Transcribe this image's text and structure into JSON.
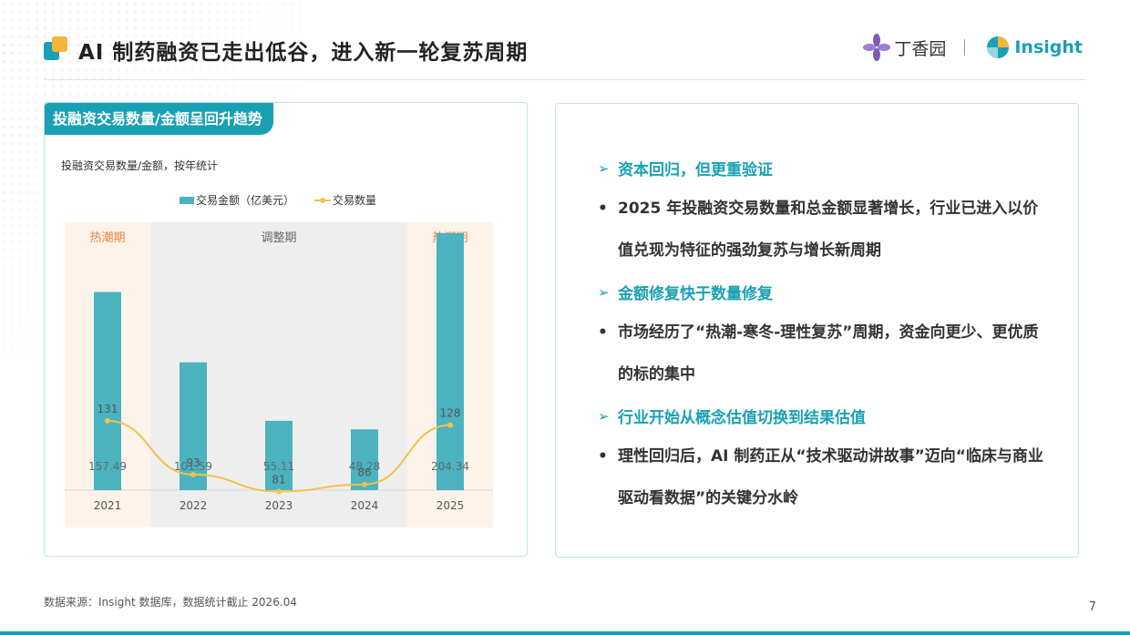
{
  "header": {
    "title": "AI 制药融资已走出低谷，进入新一轮复苏周期",
    "logo_left": "丁香园",
    "logo_right": "Insight"
  },
  "left_panel": {
    "tag": "投融资交易数量/金额呈回升趋势",
    "subtitle": "投融资交易数量/金额，按年统计"
  },
  "chart_data": {
    "type": "bar",
    "categories": [
      "2021",
      "2022",
      "2023",
      "2024",
      "2025"
    ],
    "series": [
      {
        "name": "交易金额（亿美元）",
        "kind": "bar",
        "values": [
          157.49,
          101.59,
          55.11,
          48.28,
          204.34
        ],
        "color": "#4bb3bf"
      },
      {
        "name": "交易数量",
        "kind": "line",
        "values": [
          131,
          93,
          81,
          86,
          128
        ],
        "color": "#f2c14e"
      }
    ],
    "periods": [
      {
        "label": "热潮期",
        "from": 0,
        "to": 0,
        "color": "#fdf3ea",
        "text_color": "#e8843b"
      },
      {
        "label": "调整期",
        "from": 1,
        "to": 3,
        "color": "#eeeeee",
        "text_color": "#666666"
      },
      {
        "label": "热潮期",
        "from": 4,
        "to": 4,
        "color": "#fdf3ea",
        "text_color": "#e8843b"
      }
    ],
    "legend_position": "top",
    "grid": false
  },
  "right_panel": {
    "items": [
      {
        "kind": "head",
        "text": "资本回归，但更重验证"
      },
      {
        "kind": "text",
        "text": "2025 年投融资交易数量和总金额显著增长，行业已进入以价值兑现为特征的强劲复苏与增长新周期"
      },
      {
        "kind": "head",
        "text": "金额修复快于数量修复"
      },
      {
        "kind": "text",
        "text": "市场经历了“热潮-寒冬-理性复苏”周期，资金向更少、更优质的标的集中"
      },
      {
        "kind": "head",
        "text": "行业开始从概念估值切换到结果估值"
      },
      {
        "kind": "text",
        "text": "理性回归后，AI 制药正从“技术驱动讲故事”迈向“临床与商业驱动看数据”的关键分水岭"
      }
    ],
    "head_marker": "➢",
    "text_marker": "•"
  },
  "footer": {
    "source": "数据来源：Insight 数据库，数据统计截止 2026.04",
    "page_number": "7"
  },
  "colors": {
    "accent": "#1aa0b4",
    "gold": "#f3b53a"
  }
}
